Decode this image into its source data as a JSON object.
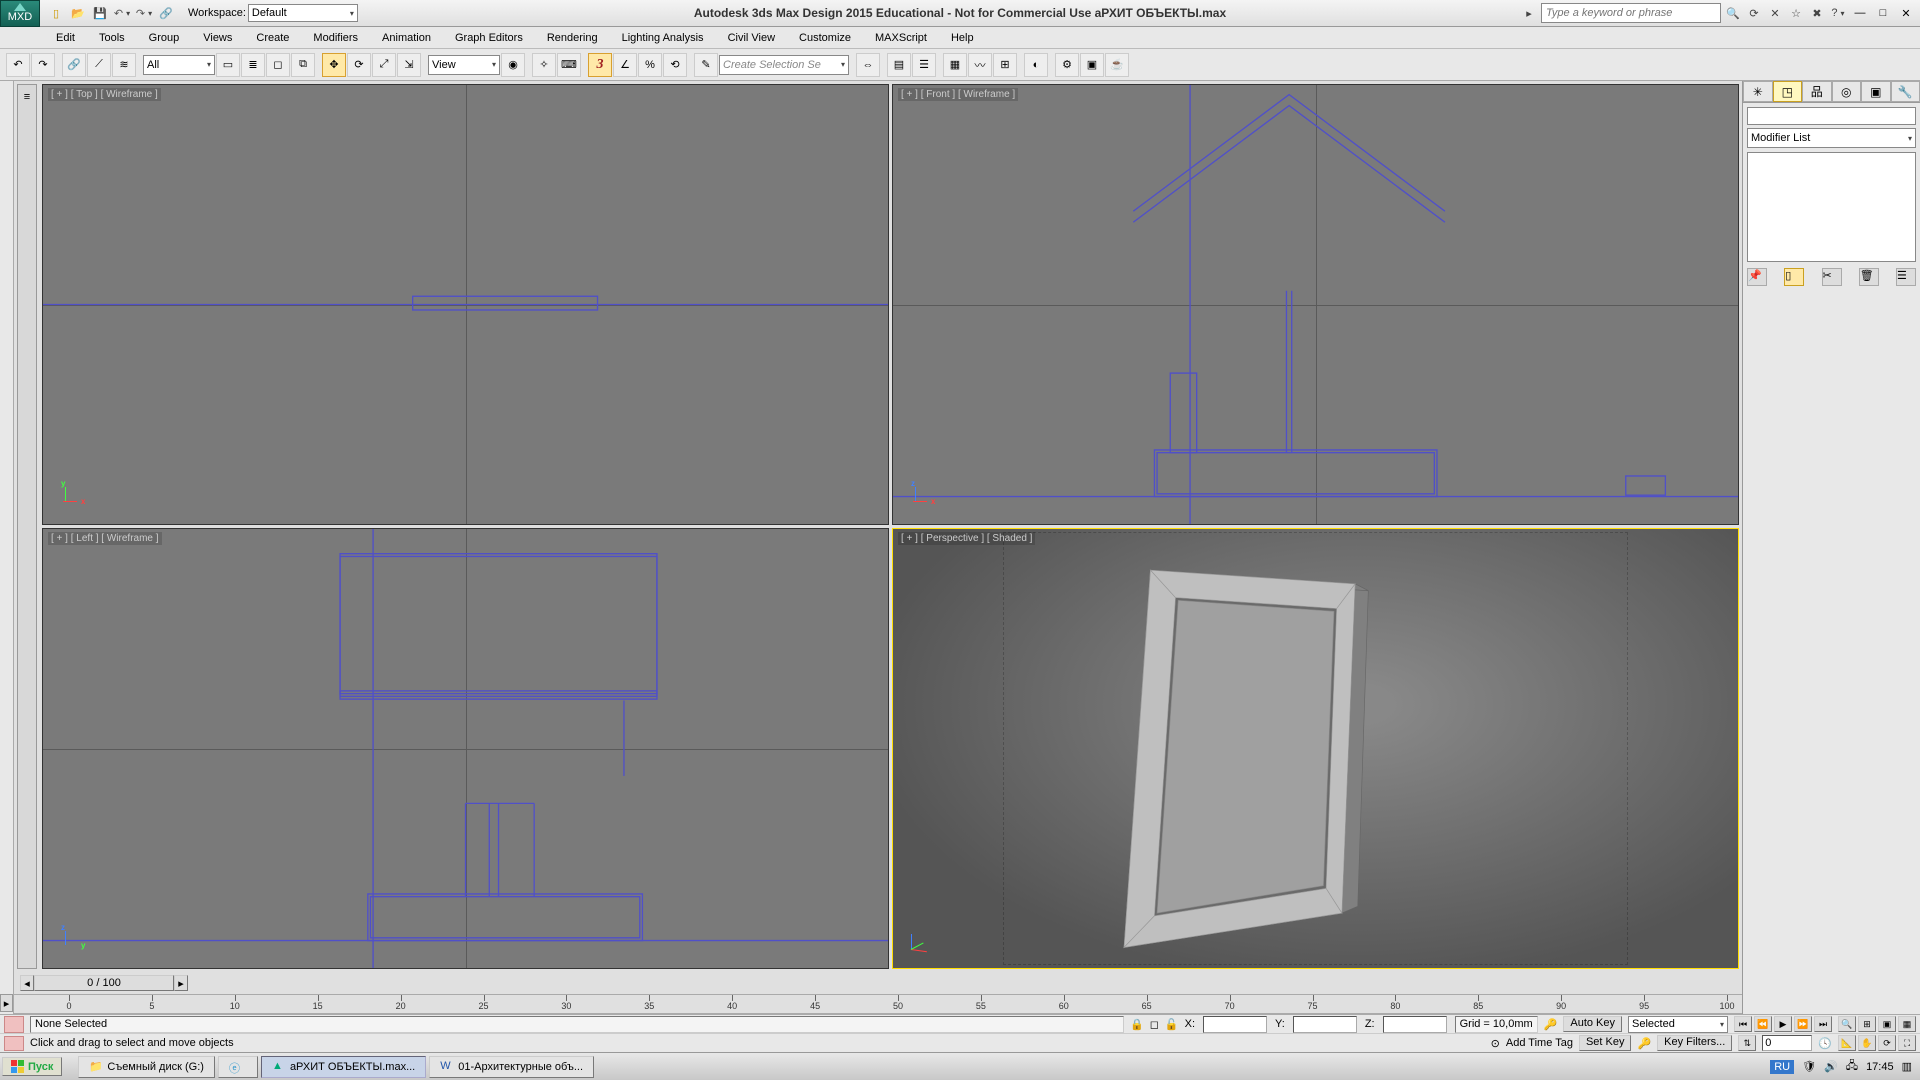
{
  "title": "Autodesk 3ds Max Design 2015  Educational - Not for Commercial Use   аРХИТ ОБЪЕКТЫ.max",
  "workspace": {
    "label": "Workspace:",
    "value": "Default"
  },
  "search_placeholder": "Type a keyword or phrase",
  "menu": [
    "Edit",
    "Tools",
    "Group",
    "Views",
    "Create",
    "Modifiers",
    "Animation",
    "Graph Editors",
    "Rendering",
    "Lighting Analysis",
    "Civil View",
    "Customize",
    "MAXScript",
    "Help"
  ],
  "toolbar": {
    "filter_combo": "All",
    "refsys_combo": "View",
    "named_sel_combo": "Create Selection Se"
  },
  "viewports": {
    "top": {
      "label": "[ + ] [ Top ] [ Wireframe ]"
    },
    "front": {
      "label": "[ + ] [ Front ] [ Wireframe ]"
    },
    "left": {
      "label": "[ + ] [ Left ] [ Wireframe ]"
    },
    "persp": {
      "label": "[ + ] [ Perspective ] [ Shaded ]"
    }
  },
  "cmd_panel": {
    "modifier_list": "Modifier List"
  },
  "timeslider": {
    "value": "0 / 100",
    "ticks": [
      "0",
      "5",
      "10",
      "15",
      "20",
      "25",
      "30",
      "35",
      "40",
      "45",
      "50",
      "55",
      "60",
      "65",
      "70",
      "75",
      "80",
      "85",
      "90",
      "95",
      "100"
    ]
  },
  "status": {
    "selection": "None Selected",
    "prompt": "Click and drag to select and move objects",
    "x_label": "X:",
    "y_label": "Y:",
    "z_label": "Z:",
    "grid": "Grid = 10,0mm",
    "time_tag": "Add Time Tag",
    "auto_key": "Auto Key",
    "set_key": "Set Key",
    "key_filters": "Key Filters...",
    "key_mode": "Selected",
    "frame": "0"
  },
  "taskbar": {
    "start": "Пуск",
    "items": [
      "Съемный диск (G:)",
      "",
      "аРХИТ ОБЪЕКТЫ.max...",
      "01-Архитектурные объ..."
    ],
    "lang": "RU",
    "time": "17:45"
  }
}
